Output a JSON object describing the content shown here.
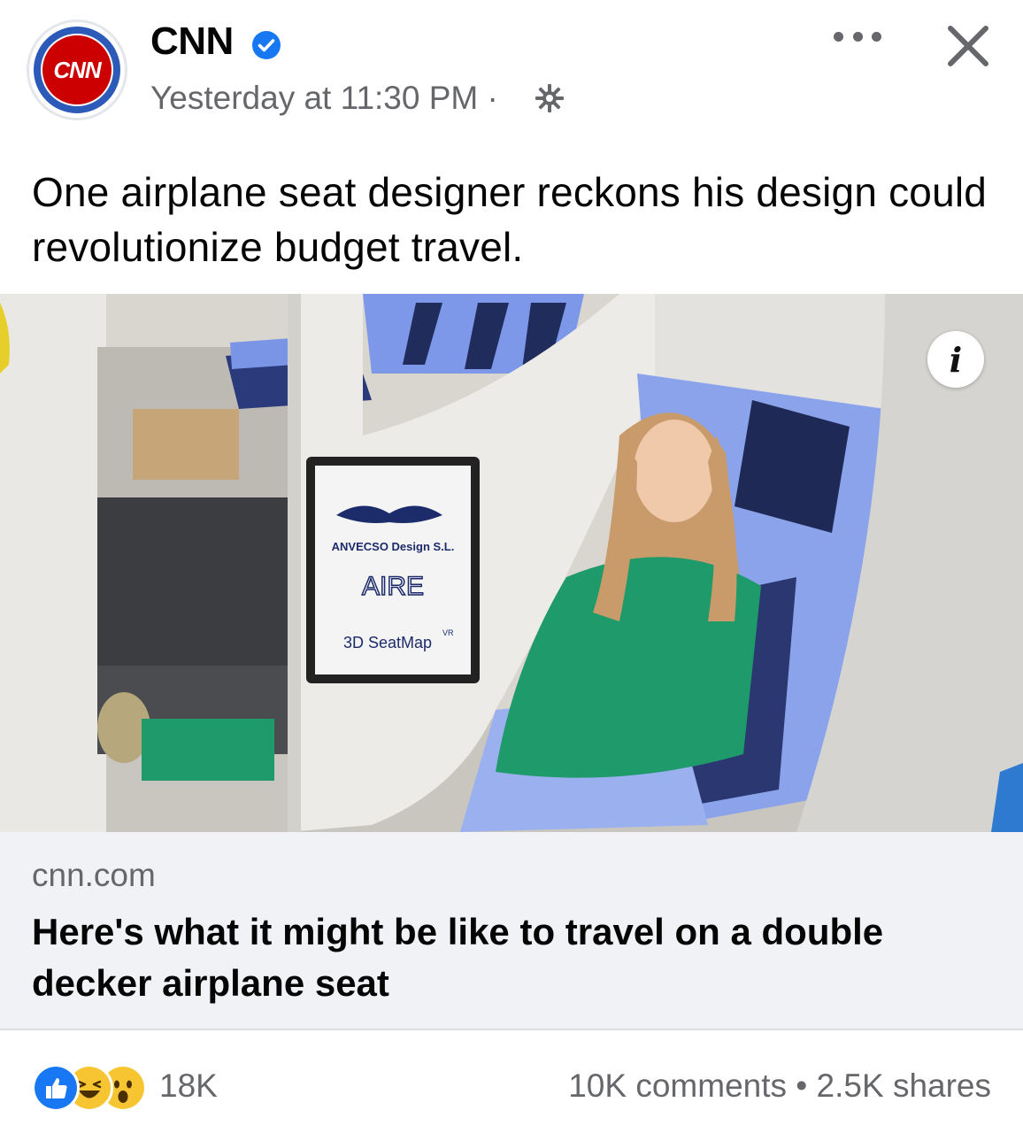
{
  "post": {
    "page_name": "CNN",
    "avatar_text": "CNN",
    "timestamp": "Yesterday at 11:30 PM",
    "timestamp_separator": "·",
    "privacy_icon": "globe-icon",
    "verified_icon": "verified-badge-icon",
    "more_icon": "more-options-icon",
    "close_icon": "close-icon",
    "text": "One airplane seat designer reckons his design could revolutionize budget travel."
  },
  "photo": {
    "alt": "Woman in green blazer seated in lower deck of a double-decker airplane seat mockup",
    "sign_brand": "ANVECSO Design S.L.",
    "sign_logo": "AIRE",
    "sign_product": "3D SeatMap",
    "sign_product_sup": "VR",
    "info_button": "i"
  },
  "link": {
    "domain": "cnn.com",
    "title": "Here's what it might be like to travel on a double decker airplane seat"
  },
  "stats": {
    "reaction_icons": [
      "like-icon",
      "haha-icon",
      "wow-icon"
    ],
    "reaction_count": "18K",
    "comments": "10K comments",
    "separator": "•",
    "shares": "2.5K shares"
  },
  "colors": {
    "facebook_blue": "#1877f2",
    "cnn_red": "#cc0000",
    "secondary_text": "#65676b",
    "card_bg": "#f0f2f5"
  }
}
